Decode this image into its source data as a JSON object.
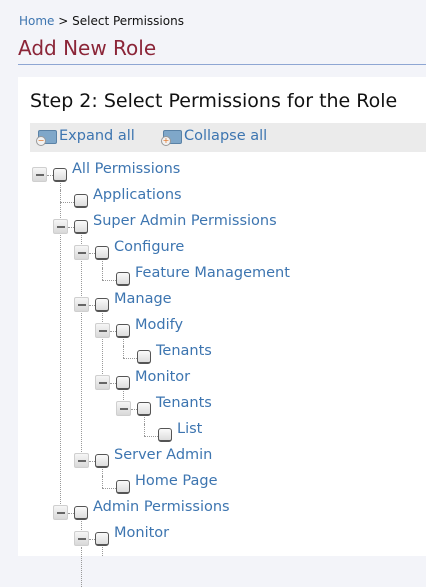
{
  "breadcrumb": {
    "home": "Home",
    "separator": ">",
    "current": "Select Permissions"
  },
  "page_title": "Add New Role",
  "step_heading": "Step 2: Select Permissions for the Role",
  "toolbar": {
    "expand_all": "Expand all",
    "collapse_all": "Collapse all"
  },
  "tree": [
    {
      "label": "All Permissions",
      "level": 0,
      "expanded": true,
      "checked": false
    },
    {
      "label": "Applications",
      "level": 1,
      "leaf": true,
      "checked": false
    },
    {
      "label": "Super Admin Permissions",
      "level": 1,
      "expanded": true,
      "checked": false
    },
    {
      "label": "Configure",
      "level": 2,
      "expanded": true,
      "checked": false
    },
    {
      "label": "Feature Management",
      "level": 3,
      "leaf": true,
      "checked": false
    },
    {
      "label": "Manage",
      "level": 2,
      "expanded": true,
      "checked": false
    },
    {
      "label": "Modify",
      "level": 3,
      "expanded": true,
      "checked": false
    },
    {
      "label": "Tenants",
      "level": 4,
      "leaf": true,
      "checked": false
    },
    {
      "label": "Monitor",
      "level": 3,
      "expanded": true,
      "checked": false
    },
    {
      "label": "Tenants",
      "level": 4,
      "expanded": true,
      "checked": false
    },
    {
      "label": "List",
      "level": 5,
      "leaf": true,
      "checked": false
    },
    {
      "label": "Server Admin",
      "level": 2,
      "expanded": true,
      "checked": false
    },
    {
      "label": "Home Page",
      "level": 3,
      "leaf": true,
      "checked": false
    },
    {
      "label": "Admin Permissions",
      "level": 1,
      "expanded": true,
      "checked": false
    },
    {
      "label": "Monitor",
      "level": 2,
      "expanded": true,
      "checked": false
    }
  ]
}
